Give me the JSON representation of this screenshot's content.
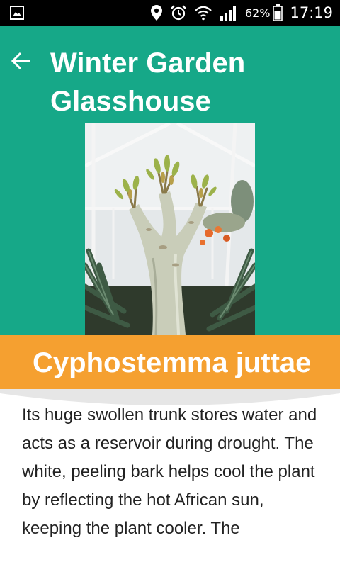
{
  "status_bar": {
    "battery_percent": "62%",
    "time": "17:19",
    "icons": [
      "gallery-notification-icon",
      "location-icon",
      "alarm-icon",
      "wifi-icon",
      "signal-icon",
      "battery-icon"
    ]
  },
  "header": {
    "back_icon": "arrow-left-icon",
    "title": "Winter Garden Glasshouse",
    "background_color": "#16a888"
  },
  "plant": {
    "photo": "plant-photo",
    "name": "Cyphostemma juttae",
    "banner_color": "#f5a030",
    "description": "Its huge swollen trunk stores water and acts as a reservoir during drought. The white, peeling bark helps cool the plant by reflecting the hot African sun, keeping the plant cooler. The"
  }
}
